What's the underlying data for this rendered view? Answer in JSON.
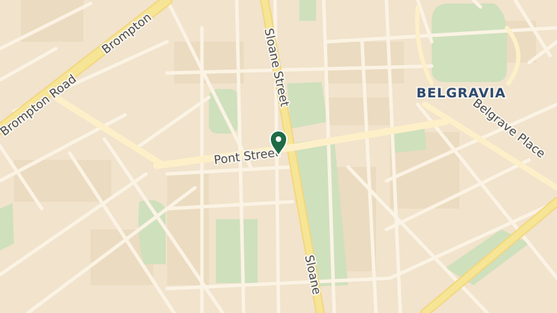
{
  "map": {
    "area_label": "BELGRAVIA",
    "street_labels": {
      "brompton_road": "Brompton Road",
      "brompton_road_2": "Brompton",
      "sloane_street": "Sloane Street",
      "sloane_street_2": "Sloane",
      "pont_street": "Pont Street",
      "belgrave_place": "Belgrave Place"
    },
    "marker": {
      "icon": "map-pin-icon",
      "color": "#1f6b45"
    },
    "colors": {
      "land": "#f1e3cc",
      "park": "#cfe0bd",
      "major_road": "#f7e596",
      "minor_road": "#fbf3e4",
      "district_text": "#2e4a6e"
    }
  }
}
